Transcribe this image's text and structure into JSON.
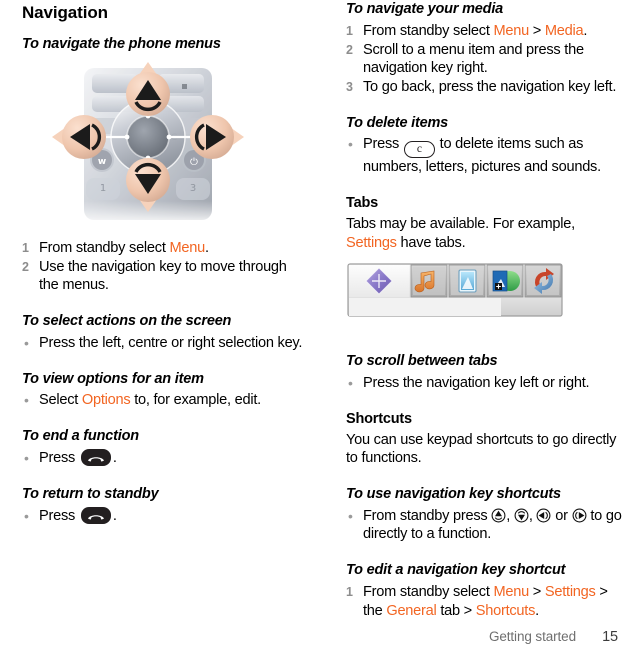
{
  "document": {
    "footer": {
      "breadcrumb": "Getting started",
      "page_number": "15"
    },
    "accent_color": "#f26522",
    "step_number_color": "#8d8d8d",
    "bullet_color": "#9a9a9a"
  },
  "left_column": {
    "section_title": "Navigation",
    "nav_phone": {
      "heading": "To navigate the phone menus",
      "figure_name": "phone-navigation-key-diagram",
      "steps": [
        {
          "pre": "From standby select ",
          "link1": "Menu",
          "post": "."
        },
        {
          "pre": "Use the navigation key to move through the menus.",
          "link1": "",
          "post": ""
        }
      ]
    },
    "select_actions": {
      "heading": "To select actions on the screen",
      "bullet": "Press the left, centre or right selection key."
    },
    "view_options": {
      "heading": "To view options for an item",
      "pre": "Select ",
      "link1": "Options",
      "post": " to, for example, edit."
    },
    "end_function": {
      "heading": "To end a function",
      "pre": "Press ",
      "key_icon": "end-call-key-icon",
      "post": "."
    },
    "return_standby": {
      "heading": "To return to standby",
      "pre": "Press ",
      "key_icon": "end-call-key-icon",
      "post": "."
    }
  },
  "right_column": {
    "nav_media": {
      "heading": "To navigate your media",
      "step1": {
        "pre": "From standby select ",
        "link1": "Menu",
        "sep": " > ",
        "link2": "Media",
        "post": "."
      },
      "step2": "Scroll to a menu item and press the navigation key right.",
      "step3": "To go back, press the navigation key left."
    },
    "delete_items": {
      "heading": "To delete items",
      "pre": "Press ",
      "key_icon": "clear-key-icon",
      "key_label": "c",
      "post": " to delete items such as numbers, letters, pictures and sounds."
    },
    "tabs": {
      "heading": "Tabs",
      "pre": "Tabs may be available. For example, ",
      "link1": "Settings",
      "post": " have tabs.",
      "figure_name": "tabs-screenshot",
      "tab_icons": [
        "navigation-diamond-icon",
        "music-note-tab-icon",
        "pictures-tab-icon",
        "video-tab-icon",
        "connectivity-tab-icon"
      ]
    },
    "scroll_tabs": {
      "heading": "To scroll between tabs",
      "bullet": "Press the navigation key left or right."
    },
    "shortcuts": {
      "heading": "Shortcuts",
      "body": "You can use keypad shortcuts to go directly to functions."
    },
    "use_nav_shortcuts": {
      "heading": "To use navigation key shortcuts",
      "pre": "From standby press ",
      "sep1": ", ",
      "sep2": ", ",
      "sep3": " or ",
      "post": " to go directly to a function.",
      "glyphs": [
        "nav-key-up-icon",
        "nav-key-down-icon",
        "nav-key-left-icon",
        "nav-key-right-icon"
      ]
    },
    "edit_nav_shortcut": {
      "heading": "To edit a navigation key shortcut",
      "step1": {
        "pre": "From standby select ",
        "link1": "Menu",
        "sep1": " > ",
        "link2": "Settings",
        "sep2": " > the ",
        "link3": "General",
        "sep3": " tab > ",
        "link4": "Shortcuts",
        "post": "."
      }
    }
  }
}
